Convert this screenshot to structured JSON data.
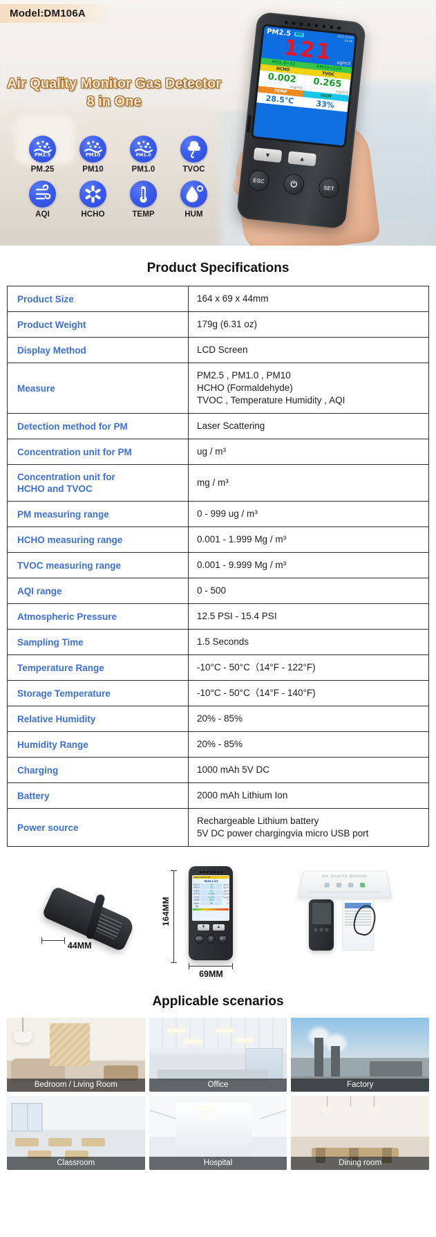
{
  "hero": {
    "model_badge": "Model:DM106A",
    "title_line1": "Air Quality Monitor Gas Detector",
    "title_line2": "8 in One",
    "features": [
      {
        "icon": "pm25-icon",
        "badge": "PM2.5",
        "label": "PM.25"
      },
      {
        "icon": "pm10-icon",
        "badge": "PM10",
        "label": "PM10"
      },
      {
        "icon": "pm1-icon",
        "badge": "PM1.0",
        "label": "PM1.0"
      },
      {
        "icon": "tvoc-icon",
        "badge": "",
        "label": "TVOC"
      },
      {
        "icon": "aqi-icon",
        "badge": "",
        "label": "AQI"
      },
      {
        "icon": "hcho-icon",
        "badge": "",
        "label": "HCHO"
      },
      {
        "icon": "temp-icon",
        "badge": "",
        "label": "TEMP"
      },
      {
        "icon": "hum-icon",
        "badge": "",
        "label": "HUM"
      }
    ],
    "device_screen": {
      "metric_label": "PM2.5",
      "metric_chip": "AQI",
      "datetime_line1": "2022-03-05",
      "datetime_line2": "04:46",
      "main_value": "121",
      "main_unit": "ug/m3",
      "pm1_label": "PM1.0=92",
      "pm10_label": "PM10=229",
      "hcho_label": "HCHO",
      "hcho_value": "0.002",
      "hcho_unit": "mg/m3",
      "tvoc_label": "TVOC",
      "tvoc_value": "0.265",
      "tvoc_unit": "mg/m3",
      "temp_label": "TEMP",
      "temp_value": "28.5°C",
      "hum_label": "HUM",
      "hum_value": "33%"
    },
    "buttons": {
      "down": "▼",
      "up": "▲",
      "esc": "ESC",
      "power": "⏻",
      "set": "SET"
    }
  },
  "spec": {
    "title": "Product Specifications",
    "rows": [
      {
        "key": "Product Size",
        "value": [
          "164 x 69 x 44mm"
        ]
      },
      {
        "key": "Product Weight",
        "value": [
          "179g (6.31 oz)"
        ]
      },
      {
        "key": "Display Method",
        "value": [
          "LCD Screen"
        ]
      },
      {
        "key": "Measure",
        "value": [
          "PM2.5 , PM1.0 , PM10",
          "HCHO (Formaldehyde)",
          "TVOC , Temperature Humidity , AQI"
        ]
      },
      {
        "key": "Detection method for PM",
        "value": [
          "Laser Scattering"
        ]
      },
      {
        "key": "Concentration unit for PM",
        "value": [
          "ug / m³"
        ]
      },
      {
        "key": "Concentration unit for HCHO and TVOC",
        "value": [
          "mg / m³"
        ],
        "key_lines": [
          "Concentration unit for",
          "HCHO and TVOC"
        ]
      },
      {
        "key": "PM measuring range",
        "value": [
          "0 - 999 ug / m³"
        ]
      },
      {
        "key": "HCHO measuring  range",
        "value": [
          "0.001 - 1.999 Mg / m³"
        ]
      },
      {
        "key": "TVOC measuring  range",
        "value": [
          "0.001 - 9.999 Mg / m³"
        ]
      },
      {
        "key": "AQI range",
        "value": [
          "0 - 500"
        ]
      },
      {
        "key": "Atmospheric Pressure",
        "value": [
          "12.5 PSI - 15.4 PSI"
        ]
      },
      {
        "key": "Sampling Time",
        "value": [
          "1.5 Seconds"
        ]
      },
      {
        "key": "Temperature Range",
        "value": [
          "-10°C - 50°C（14°F - 122°F)"
        ]
      },
      {
        "key": "Storage Temperature",
        "value": [
          "-10°C - 50°C（14°F - 140°F)"
        ]
      },
      {
        "key": "Relative Humidity",
        "value": [
          "20% - 85%"
        ]
      },
      {
        "key": "Humidity Range",
        "value": [
          "20% - 85%"
        ]
      },
      {
        "key": "Charging",
        "value": [
          "1000 mAh 5V DC"
        ]
      },
      {
        "key": "Battery",
        "value": [
          "2000 mAh Lithium Ion"
        ]
      },
      {
        "key": "Power source",
        "value": [
          "Rechargeable Lithium battery",
          "5V DC power chargingvia micro USB port"
        ]
      }
    ]
  },
  "dimensions": {
    "depth_label": "44MM",
    "height_label": "164MM",
    "width_label": "69MM",
    "front_screen": {
      "status_bar": "2022-03-05    03:09",
      "title": "Data List",
      "rows": [
        {
          "name": "PM2.5",
          "value": "34",
          "unit": "ug/m3"
        },
        {
          "name": "PM1.0",
          "value": "23",
          "unit": "ug/m3"
        },
        {
          "name": "PM10",
          "value": "47",
          "unit": "ug/m3"
        },
        {
          "name": "HCHO",
          "value": "0.035",
          "unit": "mg/m3"
        },
        {
          "name": "TVOC",
          "value": "0.102",
          "unit": "mg/m3"
        },
        {
          "name": "TEMP",
          "value": "25.5",
          "unit": "°C"
        },
        {
          "name": "HUM",
          "value": "66",
          "unit": "%"
        },
        {
          "name": "AQI",
          "value": "",
          "unit": ""
        }
      ],
      "nav": [
        "▼",
        "▲"
      ],
      "keys": [
        "ESC",
        "⏻",
        "SET"
      ]
    },
    "box_title": "Air Quality Monitor"
  },
  "scenarios": {
    "title": "Applicable scenarios",
    "items": [
      {
        "caption": "Bedroom / Living Room",
        "art": "sc-bedroom"
      },
      {
        "caption": "Office",
        "art": "sc-office"
      },
      {
        "caption": "Factory",
        "art": "sc-factory"
      },
      {
        "caption": "Classroom",
        "art": "sc-classroom"
      },
      {
        "caption": "Hospital",
        "art": "sc-hospital"
      },
      {
        "caption": "Dining room",
        "art": "sc-dining"
      }
    ]
  },
  "colors": {
    "icon_blue": "#3a5ced",
    "key_blue": "#3c6fd6",
    "value_red": "#e1172c",
    "value_green": "#0f9d23",
    "badge_peach": "#f6dec2",
    "title_gold": "#a06a24"
  }
}
